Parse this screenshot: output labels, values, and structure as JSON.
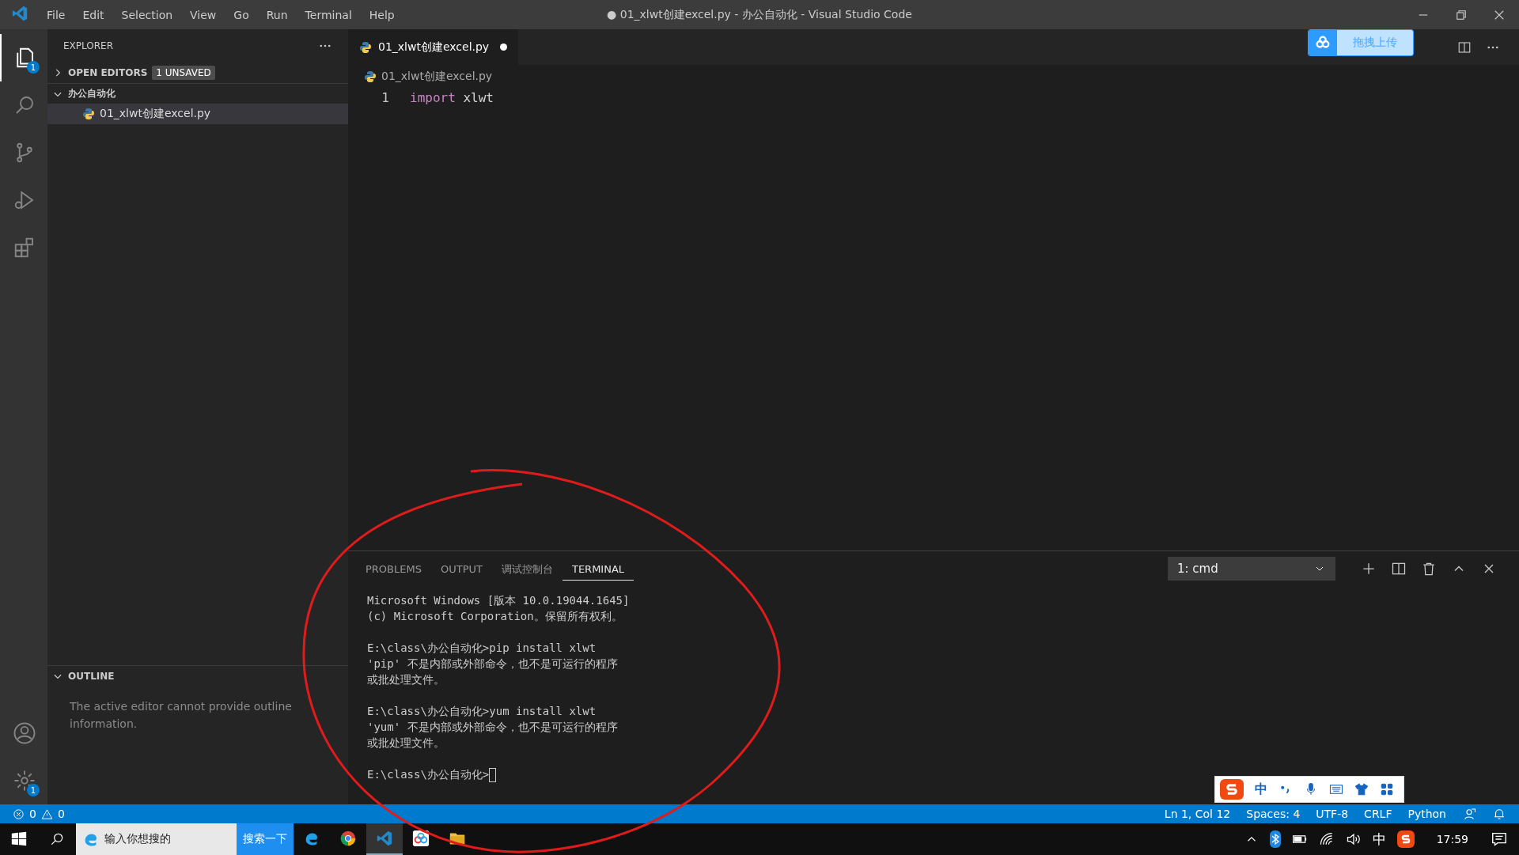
{
  "window": {
    "title": "● 01_xlwt创建excel.py - 办公自动化 - Visual Studio Code"
  },
  "menu": [
    "File",
    "Edit",
    "Selection",
    "View",
    "Go",
    "Run",
    "Terminal",
    "Help"
  ],
  "activity_bar": [
    {
      "kind": "files",
      "selected": true,
      "badge": "1"
    },
    {
      "kind": "search",
      "selected": false
    },
    {
      "kind": "git",
      "selected": false
    },
    {
      "kind": "debug",
      "selected": false
    },
    {
      "kind": "extensions",
      "selected": false
    }
  ],
  "activity_bottom": [
    {
      "kind": "account"
    },
    {
      "kind": "settings",
      "badge": "1"
    }
  ],
  "sidebar": {
    "title": "EXPLORER",
    "open_editors": {
      "label": "OPEN EDITORS",
      "badge": "1 UNSAVED",
      "expanded": false
    },
    "folder": {
      "label": "办公自动化",
      "expanded": true,
      "children": [
        {
          "label": "01_xlwt创建excel.py",
          "selected": true
        }
      ]
    },
    "outline": {
      "label": "OUTLINE",
      "expanded": true,
      "message": "The active editor cannot provide outline information."
    }
  },
  "editor": {
    "tabs": [
      {
        "label": "01_xlwt创建excel.py",
        "selected": true,
        "unsaved": true
      }
    ],
    "breadcrumb": "01_xlwt创建excel.py",
    "lines": [
      {
        "number": "1",
        "keyword": "import",
        "rest": " xlwt"
      }
    ],
    "upload_button": "拖拽上传"
  },
  "panel": {
    "tabs": [
      {
        "label": "PROBLEMS",
        "selected": false
      },
      {
        "label": "OUTPUT",
        "selected": false
      },
      {
        "label": "调试控制台",
        "selected": false
      },
      {
        "label": "TERMINAL",
        "selected": true
      }
    ],
    "terminal_select": "1: cmd",
    "terminal": [
      [
        "Microsoft Windows [版本 10.0.19044.1645]",
        "(c) Microsoft Corporation。保留所有权利。"
      ],
      [
        "E:\\class\\办公自动化>pip install xlwt",
        "'pip' 不是内部或外部命令，也不是可运行的程序",
        "或批处理文件。"
      ],
      [
        "E:\\class\\办公自动化>yum install xlwt",
        "'yum' 不是内部或外部命令，也不是可运行的程序",
        "或批处理文件。"
      ],
      [
        "E:\\class\\办公自动化>"
      ]
    ]
  },
  "status_bar": {
    "errors": "0",
    "warnings": "0",
    "right": [
      "Ln 1, Col 12",
      "Spaces: 4",
      "UTF-8",
      "CRLF",
      "Python"
    ]
  },
  "ime_bar": {
    "mode": "中"
  },
  "taskbar": {
    "search_placeholder": "输入你想搜的",
    "search_button": "搜索一下",
    "apps": [
      {
        "kind": "edge",
        "selected": false
      },
      {
        "kind": "chrome",
        "selected": false
      },
      {
        "kind": "vscode",
        "selected": true
      },
      {
        "kind": "cloud",
        "selected": false
      },
      {
        "kind": "folder",
        "selected": false
      }
    ],
    "input_mode": "中",
    "time": "17:59"
  }
}
